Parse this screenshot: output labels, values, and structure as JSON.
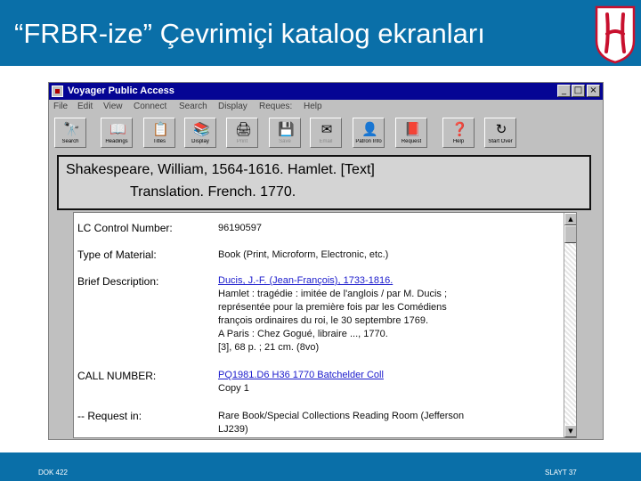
{
  "slide": {
    "title": "“FRBR-ize” Çevrimiçi katalog ekranları",
    "footer_left": "DOK 422",
    "footer_right": "SLAYT 37"
  },
  "window": {
    "title": "Voyager Public Access",
    "minimize": "_",
    "maximize": "□",
    "close": "×"
  },
  "menu": [
    "File",
    "Edit",
    "View",
    "Connect",
    "Search",
    "Display",
    "Reques:",
    "Help"
  ],
  "toolbar": [
    {
      "label": "Search",
      "icon": "🔭"
    },
    {
      "label": "Headings",
      "icon": "📖"
    },
    {
      "label": "Titles",
      "icon": "📋"
    },
    {
      "label": "Display",
      "icon": "📚"
    },
    {
      "label": "Print",
      "icon": "🖨"
    },
    {
      "label": "Save",
      "icon": "💾"
    },
    {
      "label": "Email",
      "icon": "✉"
    },
    {
      "label": "Patron Info",
      "icon": "👤"
    },
    {
      "label": "Request",
      "icon": "📕"
    },
    {
      "label": "Help",
      "icon": "❓"
    },
    {
      "label": "Start Over",
      "icon": "↻"
    }
  ],
  "callout": {
    "line1": "Shakespeare, William, 1564-1616.  Hamlet. [Text]",
    "line2": "Translation.  French.  1770."
  },
  "record": {
    "lccn_label": "LC Control Number:",
    "lccn_value": "96190597",
    "type_label": "Type of Material:",
    "type_value": "Book (Print, Microform, Electronic, etc.)",
    "brief_label": "Brief Description:",
    "brief_lines": [
      "Ducis, J.-F. (Jean-François), 1733-1816.",
      "Hamlet : tragédie : imitée de l'anglois / par M. Ducis ;",
      "  représentée pour la première fois par les Comédiens",
      "  françois ordinaires du roi, le 30 septembre 1769.",
      "A Paris : Chez Gogué, libraire ..., 1770.",
      "[3], 68 p. ; 21 cm. (8vo)"
    ],
    "call_label": "CALL NUMBER:",
    "call_value": "PQ1981.D6 H36 1770 Batchelder Coll",
    "copy_value": "Copy 1",
    "request_label": "-- Request in:",
    "request_lines": [
      "Rare Book/Special Collections Reading Room (Jefferson",
      "  LJ239)"
    ]
  },
  "colors": {
    "slide_blue": "#0a6fa8",
    "titlebar": "#050594",
    "link": "#1a1acc",
    "logo_red": "#c8102e"
  }
}
